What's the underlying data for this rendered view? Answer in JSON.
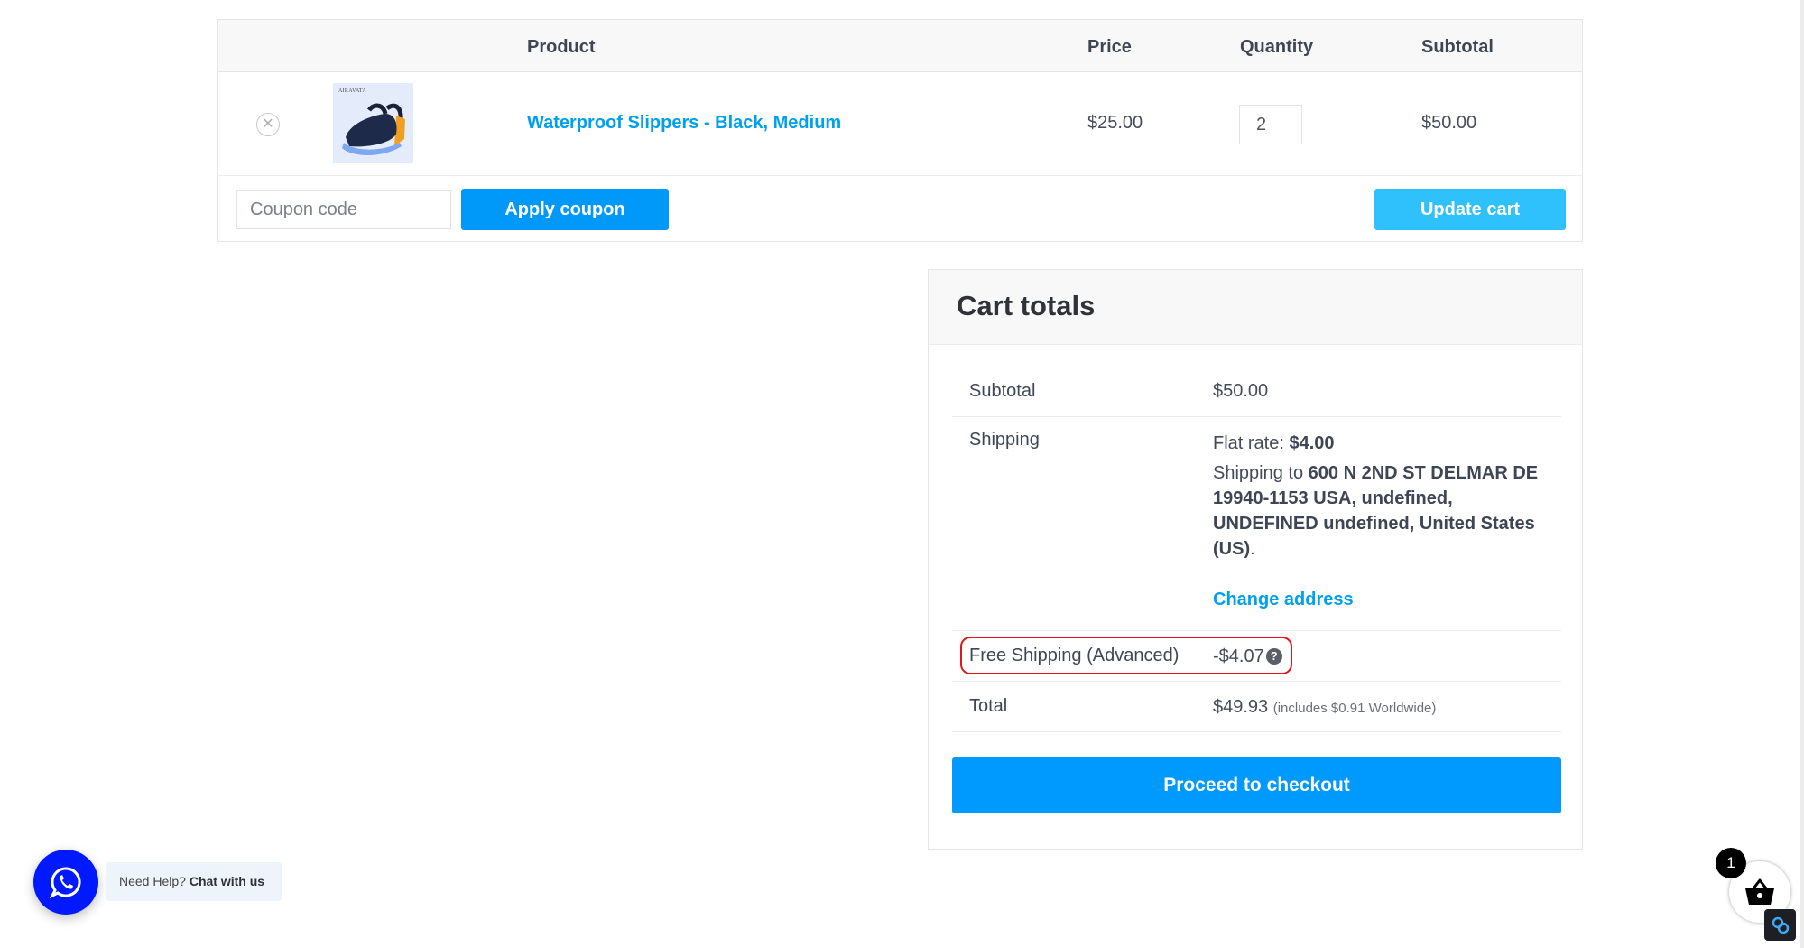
{
  "cart": {
    "headers": {
      "product": "Product",
      "price": "Price",
      "quantity": "Quantity",
      "subtotal": "Subtotal"
    },
    "items": [
      {
        "thumbnail_brand": "AIRAVATA",
        "name": "Waterproof Slippers - Black, Medium",
        "price": "$25.00",
        "quantity": "2",
        "subtotal": "$50.00",
        "remove_icon": "remove-circle-x-icon"
      }
    ],
    "coupon": {
      "placeholder": "Coupon code",
      "value": ""
    },
    "apply_coupon_label": "Apply coupon",
    "update_cart_label": "Update cart"
  },
  "totals": {
    "title": "Cart totals",
    "subtotal": {
      "label": "Subtotal",
      "value": "$50.00"
    },
    "shipping": {
      "label": "Shipping",
      "method_prefix": "Flat rate: ",
      "method_amount": "$4.00",
      "shipping_to_prefix": "Shipping to ",
      "address": "600 N 2ND ST DELMAR DE 19940-1153 USA, undefined, UNDEFINED undefined, United States (US)",
      "address_suffix": ".",
      "change_address_label": "Change address"
    },
    "discount": {
      "label": "Free Shipping (Advanced)",
      "value": "-$4.07",
      "help_icon": "question-circle-icon"
    },
    "total": {
      "label": "Total",
      "value": "$49.93",
      "note": "(includes $0.91 Worldwide)"
    },
    "checkout_label": "Proceed to checkout"
  },
  "chat_widget": {
    "icon": "whatsapp-icon",
    "prefix": "Need Help? ",
    "cta": "Chat with us",
    "color": "#0019ff"
  },
  "mini_cart": {
    "icon": "basket-icon",
    "count": "1"
  },
  "link_widget": {
    "icon": "link-icon"
  },
  "colors": {
    "link": "#00a1ec",
    "primary_button": "#0099f9",
    "update_button": "#2ec1fb",
    "highlight_outline": "#e0161b"
  }
}
